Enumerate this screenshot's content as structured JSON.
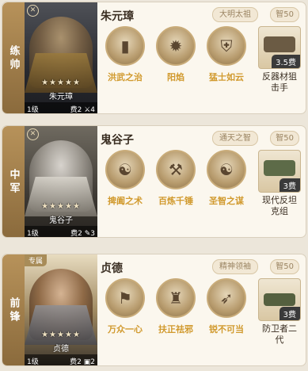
{
  "cards": [
    {
      "position": "练帅",
      "hero_name": "朱元璋",
      "stars": "★★★★★",
      "level": "1级",
      "cost_label": "费2",
      "extra": "4",
      "tag1": "大明太祖",
      "tag2": "智50",
      "special": "",
      "skills": [
        "洪武之治",
        "阳焰",
        "猛士如云"
      ],
      "skill_icons": [
        "pillar-icon",
        "flame-icon",
        "helmet-icon"
      ],
      "equip_cost": "3.5费",
      "equip_name": "反器材狙击手"
    },
    {
      "position": "中军",
      "hero_name": "鬼谷子",
      "stars": "★★★★★",
      "level": "1级",
      "cost_label": "费2",
      "extra": "3",
      "tag1": "通天之智",
      "tag2": "智50",
      "special": "",
      "skills": [
        "捭阖之术",
        "百炼千锤",
        "圣智之谋"
      ],
      "skill_icons": [
        "sage-icon",
        "anvil-icon",
        "sage-icon"
      ],
      "equip_cost": "3费",
      "equip_name": "现代反坦克组"
    },
    {
      "position": "前锋",
      "hero_name": "贞德",
      "stars": "★★★★★",
      "level": "1级",
      "cost_label": "费2",
      "extra": "2",
      "tag1": "精神领袖",
      "tag2": "智50",
      "special": "专属",
      "skills": [
        "万众一心",
        "扶正祛邪",
        "锐不可当"
      ],
      "skill_icons": [
        "rally-icon",
        "statue-icon",
        "rush-icon"
      ],
      "equip_cost": "3费",
      "equip_name": "防卫者二代"
    }
  ]
}
